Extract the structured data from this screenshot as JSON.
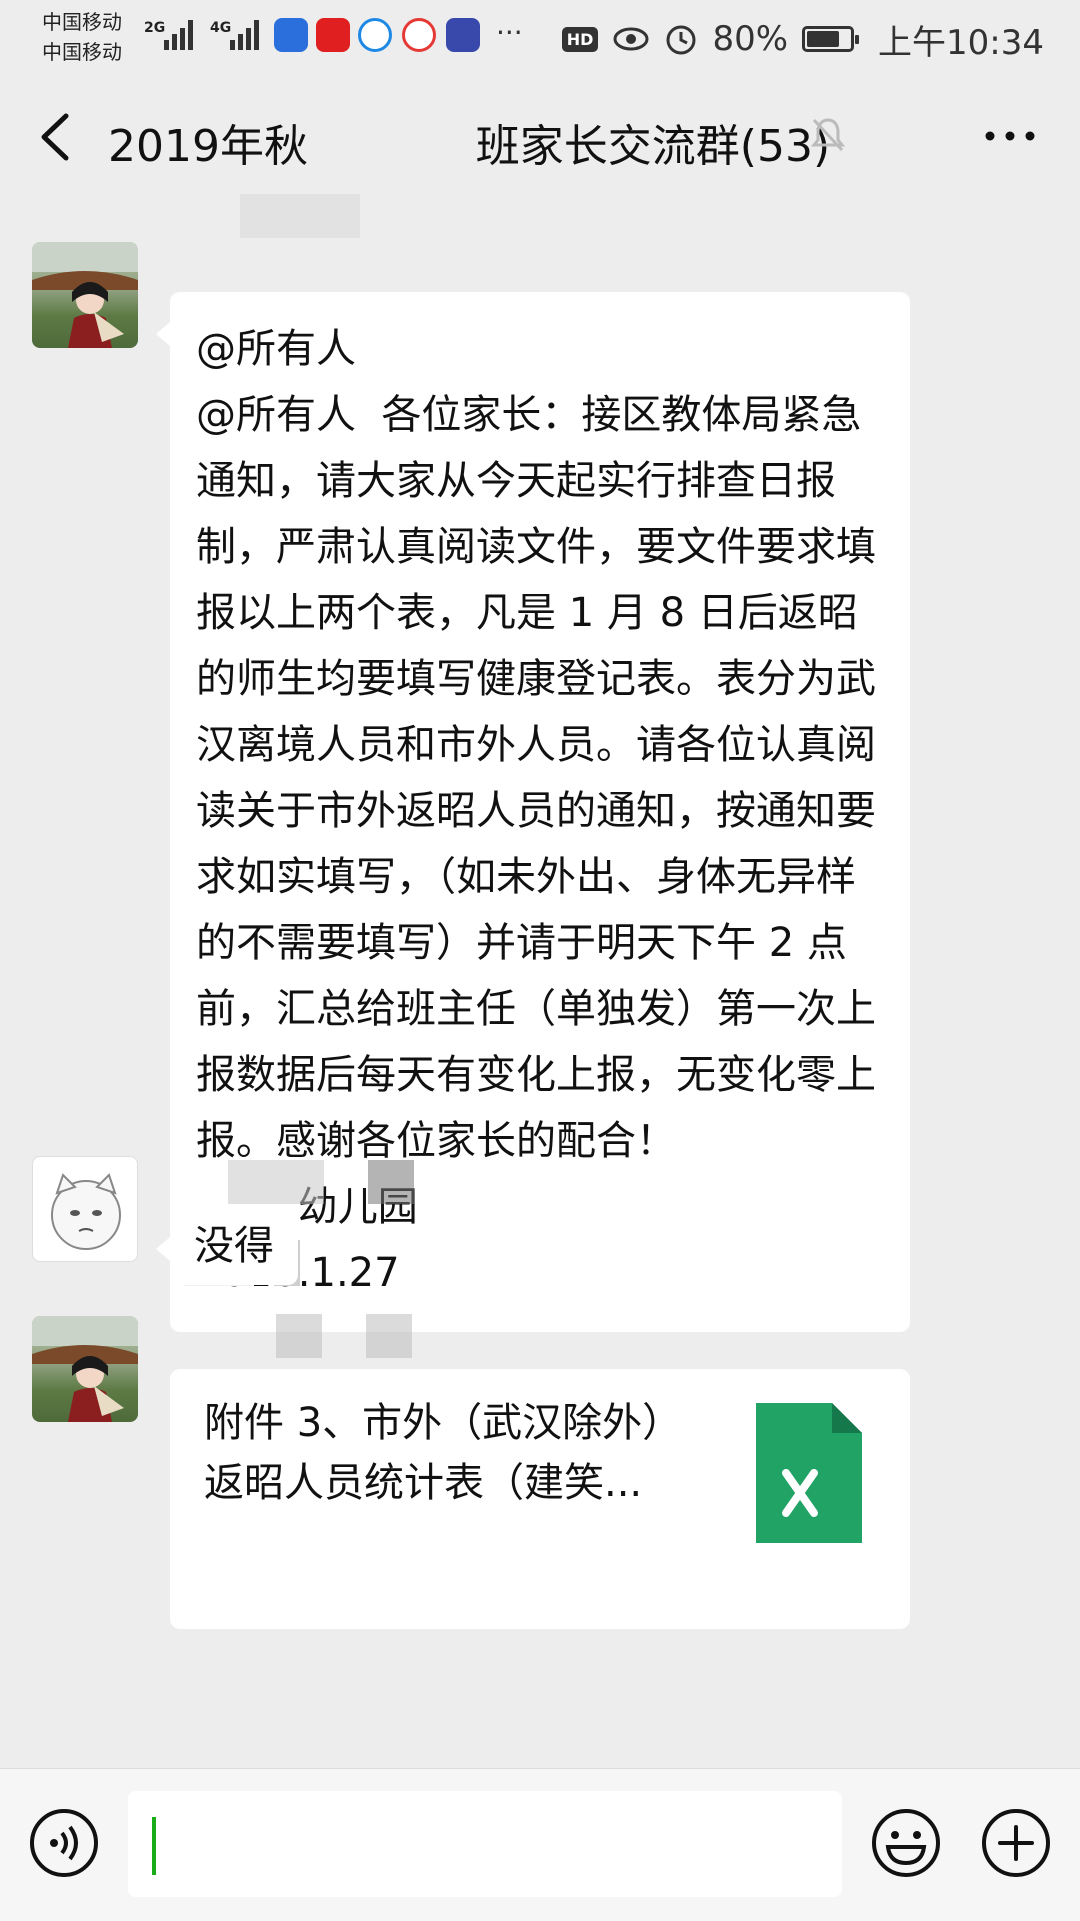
{
  "status_bar": {
    "carrier1": "中国移动",
    "carrier2": "中国移动",
    "network1": "2G",
    "network2": "4G",
    "hd": "HD",
    "battery": "80%",
    "battery_level": 0.8,
    "time": "上午10:34"
  },
  "header": {
    "title": "2019年秋            班家长交流群(53)"
  },
  "messages": [
    {
      "text": "@所有人\n@所有人  各位家长：接区教体局紧急通知，请大家从今天起实行排查日报制，严肃认真阅读文件，要文件要求填报以上两个表，凡是 1 月 8 日后返昭的师生均要填写健康登记表。表分为武汉离境人员和市外人员。请各位认真阅读关于市外返昭人员的通知，按通知要求如实填写，（如未外出、身体无异样的不需要填写）并请于明天下午 2 点前，汇总给班主任（单独发）第一次上报数据后每天有变化上报，无变化零上报。感谢各位家长的配合！\n        幼儿园\n2020.1.27"
    },
    {
      "text": "没得"
    },
    {
      "file_name": "附件 3、市外（武汉除外）返昭人员统计表（建笑..."
    }
  ],
  "colors": {
    "background": "#ededed",
    "bubble": "#ffffff",
    "accent_green": "#1aad19",
    "excel_green": "#21a366"
  }
}
